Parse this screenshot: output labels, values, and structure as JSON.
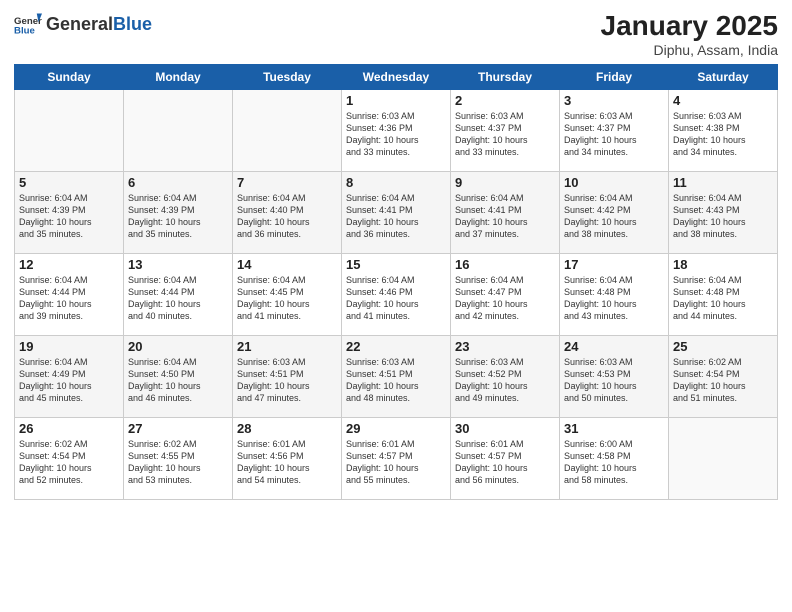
{
  "header": {
    "logo_general": "General",
    "logo_blue": "Blue",
    "month_title": "January 2025",
    "location": "Diphu, Assam, India"
  },
  "days_of_week": [
    "Sunday",
    "Monday",
    "Tuesday",
    "Wednesday",
    "Thursday",
    "Friday",
    "Saturday"
  ],
  "weeks": [
    [
      {
        "day": "",
        "info": ""
      },
      {
        "day": "",
        "info": ""
      },
      {
        "day": "",
        "info": ""
      },
      {
        "day": "1",
        "info": "Sunrise: 6:03 AM\nSunset: 4:36 PM\nDaylight: 10 hours\nand 33 minutes."
      },
      {
        "day": "2",
        "info": "Sunrise: 6:03 AM\nSunset: 4:37 PM\nDaylight: 10 hours\nand 33 minutes."
      },
      {
        "day": "3",
        "info": "Sunrise: 6:03 AM\nSunset: 4:37 PM\nDaylight: 10 hours\nand 34 minutes."
      },
      {
        "day": "4",
        "info": "Sunrise: 6:03 AM\nSunset: 4:38 PM\nDaylight: 10 hours\nand 34 minutes."
      }
    ],
    [
      {
        "day": "5",
        "info": "Sunrise: 6:04 AM\nSunset: 4:39 PM\nDaylight: 10 hours\nand 35 minutes."
      },
      {
        "day": "6",
        "info": "Sunrise: 6:04 AM\nSunset: 4:39 PM\nDaylight: 10 hours\nand 35 minutes."
      },
      {
        "day": "7",
        "info": "Sunrise: 6:04 AM\nSunset: 4:40 PM\nDaylight: 10 hours\nand 36 minutes."
      },
      {
        "day": "8",
        "info": "Sunrise: 6:04 AM\nSunset: 4:41 PM\nDaylight: 10 hours\nand 36 minutes."
      },
      {
        "day": "9",
        "info": "Sunrise: 6:04 AM\nSunset: 4:41 PM\nDaylight: 10 hours\nand 37 minutes."
      },
      {
        "day": "10",
        "info": "Sunrise: 6:04 AM\nSunset: 4:42 PM\nDaylight: 10 hours\nand 38 minutes."
      },
      {
        "day": "11",
        "info": "Sunrise: 6:04 AM\nSunset: 4:43 PM\nDaylight: 10 hours\nand 38 minutes."
      }
    ],
    [
      {
        "day": "12",
        "info": "Sunrise: 6:04 AM\nSunset: 4:44 PM\nDaylight: 10 hours\nand 39 minutes."
      },
      {
        "day": "13",
        "info": "Sunrise: 6:04 AM\nSunset: 4:44 PM\nDaylight: 10 hours\nand 40 minutes."
      },
      {
        "day": "14",
        "info": "Sunrise: 6:04 AM\nSunset: 4:45 PM\nDaylight: 10 hours\nand 41 minutes."
      },
      {
        "day": "15",
        "info": "Sunrise: 6:04 AM\nSunset: 4:46 PM\nDaylight: 10 hours\nand 41 minutes."
      },
      {
        "day": "16",
        "info": "Sunrise: 6:04 AM\nSunset: 4:47 PM\nDaylight: 10 hours\nand 42 minutes."
      },
      {
        "day": "17",
        "info": "Sunrise: 6:04 AM\nSunset: 4:48 PM\nDaylight: 10 hours\nand 43 minutes."
      },
      {
        "day": "18",
        "info": "Sunrise: 6:04 AM\nSunset: 4:48 PM\nDaylight: 10 hours\nand 44 minutes."
      }
    ],
    [
      {
        "day": "19",
        "info": "Sunrise: 6:04 AM\nSunset: 4:49 PM\nDaylight: 10 hours\nand 45 minutes."
      },
      {
        "day": "20",
        "info": "Sunrise: 6:04 AM\nSunset: 4:50 PM\nDaylight: 10 hours\nand 46 minutes."
      },
      {
        "day": "21",
        "info": "Sunrise: 6:03 AM\nSunset: 4:51 PM\nDaylight: 10 hours\nand 47 minutes."
      },
      {
        "day": "22",
        "info": "Sunrise: 6:03 AM\nSunset: 4:51 PM\nDaylight: 10 hours\nand 48 minutes."
      },
      {
        "day": "23",
        "info": "Sunrise: 6:03 AM\nSunset: 4:52 PM\nDaylight: 10 hours\nand 49 minutes."
      },
      {
        "day": "24",
        "info": "Sunrise: 6:03 AM\nSunset: 4:53 PM\nDaylight: 10 hours\nand 50 minutes."
      },
      {
        "day": "25",
        "info": "Sunrise: 6:02 AM\nSunset: 4:54 PM\nDaylight: 10 hours\nand 51 minutes."
      }
    ],
    [
      {
        "day": "26",
        "info": "Sunrise: 6:02 AM\nSunset: 4:54 PM\nDaylight: 10 hours\nand 52 minutes."
      },
      {
        "day": "27",
        "info": "Sunrise: 6:02 AM\nSunset: 4:55 PM\nDaylight: 10 hours\nand 53 minutes."
      },
      {
        "day": "28",
        "info": "Sunrise: 6:01 AM\nSunset: 4:56 PM\nDaylight: 10 hours\nand 54 minutes."
      },
      {
        "day": "29",
        "info": "Sunrise: 6:01 AM\nSunset: 4:57 PM\nDaylight: 10 hours\nand 55 minutes."
      },
      {
        "day": "30",
        "info": "Sunrise: 6:01 AM\nSunset: 4:57 PM\nDaylight: 10 hours\nand 56 minutes."
      },
      {
        "day": "31",
        "info": "Sunrise: 6:00 AM\nSunset: 4:58 PM\nDaylight: 10 hours\nand 58 minutes."
      },
      {
        "day": "",
        "info": ""
      }
    ]
  ]
}
